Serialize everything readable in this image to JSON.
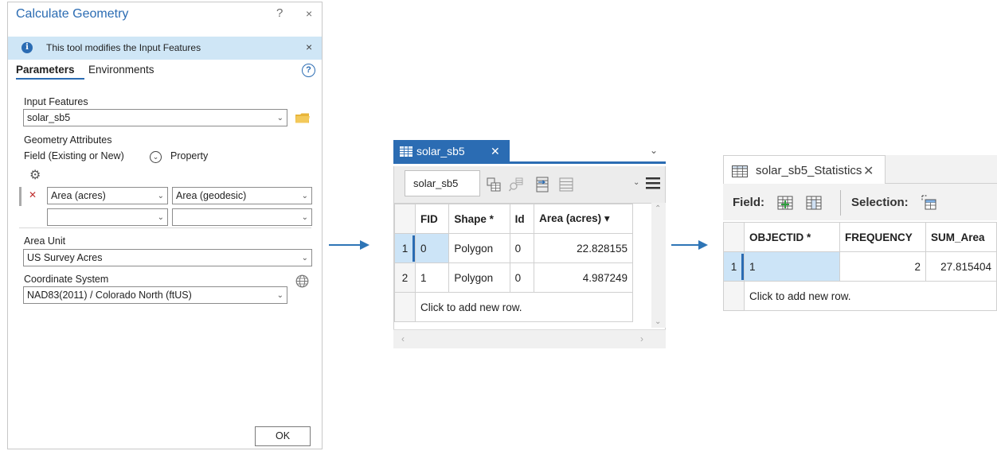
{
  "calc": {
    "title": "Calculate Geometry",
    "help_symbol": "?",
    "close_symbol": "×",
    "info_text": "This tool modifies the Input Features",
    "info_symbol": "i",
    "tab_parameters": "Parameters",
    "tab_environments": "Environments",
    "help_circle_symbol": "?",
    "input_features_label": "Input Features",
    "input_features_value": "solar_sb5",
    "geometry_attributes_label": "Geometry Attributes",
    "field_label": "Field (Existing or New)",
    "property_label": "Property",
    "row1_field": "Area (acres)",
    "row1_property": "Area (geodesic)",
    "row2_field": "",
    "row2_property": "",
    "area_unit_label": "Area Unit",
    "area_unit_value": "US Survey Acres",
    "coord_system_label": "Coordinate System",
    "coord_system_value": "NAD83(2011) / Colorado North (ftUS)",
    "ok_label": "OK"
  },
  "table1": {
    "tab_label": "solar_sb5",
    "tooltip": "solar_sb5",
    "headers": [
      "FID",
      "Shape *",
      "Id",
      "Area (acres) ▾"
    ],
    "rows": [
      {
        "row": "1",
        "fid": "0",
        "shape": "Polygon",
        "id": "0",
        "area": "22.828155"
      },
      {
        "row": "2",
        "fid": "1",
        "shape": "Polygon",
        "id": "0",
        "area": "4.987249"
      }
    ],
    "add_row": "Click to add new row."
  },
  "table2": {
    "tab_label": "solar_sb5_Statistics",
    "field_label": "Field:",
    "selection_label": "Selection:",
    "headers": [
      "OBJECTID *",
      "FREQUENCY",
      "SUM_Area"
    ],
    "rows": [
      {
        "row": "1",
        "objectid": "1",
        "frequency": "2",
        "sum_area": "27.815404"
      }
    ],
    "add_row": "Click to add new row."
  },
  "colors": {
    "accent": "#2b6cb3",
    "info_bg": "#cfe6f6",
    "selection": "#cce4f7",
    "arrow": "#2e75b6"
  }
}
